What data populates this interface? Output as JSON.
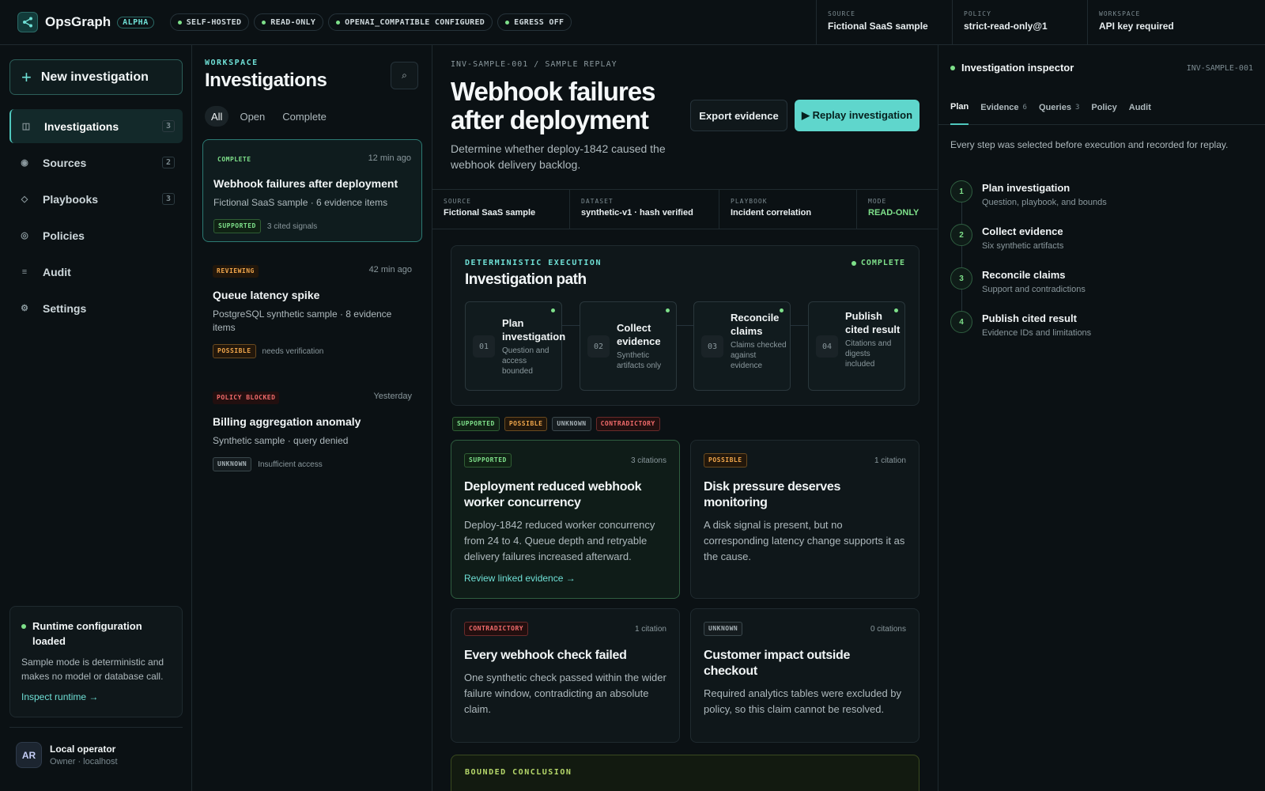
{
  "app": {
    "name": "OpsGraph",
    "badge": "ALPHA"
  },
  "header": {
    "chips": [
      "SELF-HOSTED",
      "READ-ONLY",
      "OPENAI_COMPATIBLE CONFIGURED",
      "EGRESS OFF"
    ],
    "meta": [
      {
        "label": "SOURCE",
        "value": "Fictional SaaS sample"
      },
      {
        "label": "POLICY",
        "value": "strict-read-only@1"
      },
      {
        "label": "WORKSPACE",
        "value": "API key required"
      }
    ]
  },
  "sidebar": {
    "new_button": "New investigation",
    "nav": [
      {
        "label": "Investigations",
        "count": "3",
        "icon": "grid-icon"
      },
      {
        "label": "Sources",
        "count": "2",
        "icon": "source-icon"
      },
      {
        "label": "Playbooks",
        "count": "3",
        "icon": "diamond-icon"
      },
      {
        "label": "Policies",
        "count": "",
        "icon": "policy-icon"
      },
      {
        "label": "Audit",
        "count": "",
        "icon": "list-icon"
      },
      {
        "label": "Settings",
        "count": "",
        "icon": "gear-icon"
      }
    ],
    "runtime": {
      "title": "Runtime configuration loaded",
      "body": "Sample mode is deterministic and makes no model or database call.",
      "link": "Inspect runtime →"
    },
    "user": {
      "initials": "AR",
      "name": "Local operator",
      "sub": "Owner · localhost"
    }
  },
  "list": {
    "eyebrow": "WORKSPACE",
    "title": "Investigations",
    "filters": [
      "All",
      "Open",
      "Complete"
    ],
    "items": [
      {
        "status": "COMPLETE",
        "time": "12 min ago",
        "title": "Webhook failures after deployment",
        "sub": "Fictional SaaS sample · 6 evidence items",
        "tag": "SUPPORTED",
        "note": "3 cited signals"
      },
      {
        "status": "REVIEWING",
        "time": "42 min ago",
        "title": "Queue latency spike",
        "sub": "PostgreSQL synthetic sample · 8 evidence items",
        "tag": "POSSIBLE",
        "note": "needs verification"
      },
      {
        "status": "POLICY BLOCKED",
        "time": "Yesterday",
        "title": "Billing aggregation anomaly",
        "sub": "Synthetic sample · query denied",
        "tag": "UNKNOWN",
        "note": "Insufficient access"
      }
    ]
  },
  "main": {
    "crumb": "INV-SAMPLE-001 / SAMPLE REPLAY",
    "title": "Webhook failures after deployment",
    "description": "Determine whether deploy-1842 caused the webhook delivery backlog.",
    "export_label": "Export evidence",
    "replay_label": "▶ Replay investigation",
    "meta": [
      {
        "label": "SOURCE",
        "value": "Fictional SaaS sample"
      },
      {
        "label": "DATASET",
        "value": "synthetic-v1 · hash verified"
      },
      {
        "label": "PLAYBOOK",
        "value": "Incident correlation"
      },
      {
        "label": "MODE",
        "value": "READ-ONLY"
      }
    ],
    "path": {
      "eyebrow": "DETERMINISTIC EXECUTION",
      "title": "Investigation path",
      "status": "COMPLETE",
      "steps": [
        {
          "num": "01",
          "title": "Plan investigation",
          "desc": "Question and access bounded"
        },
        {
          "num": "02",
          "title": "Collect evidence",
          "desc": "Synthetic artifacts only"
        },
        {
          "num": "03",
          "title": "Reconcile claims",
          "desc": "Claims checked against evidence"
        },
        {
          "num": "04",
          "title": "Publish cited result",
          "desc": "Citations and digests included"
        }
      ]
    },
    "legend": [
      "SUPPORTED",
      "POSSIBLE",
      "UNKNOWN",
      "CONTRADICTORY"
    ],
    "claims": [
      {
        "tag": "SUPPORTED",
        "citations": "3 citations",
        "title": "Deployment reduced webhook worker concurrency",
        "body": "Deploy-1842 reduced worker concurrency from 24 to 4. Queue depth and retryable delivery failures increased afterward.",
        "link": "Review linked evidence  →"
      },
      {
        "tag": "POSSIBLE",
        "citations": "1 citation",
        "title": "Disk pressure deserves monitoring",
        "body": "A disk signal is present, but no corresponding latency change supports it as the cause."
      },
      {
        "tag": "CONTRADICTORY",
        "citations": "1 citation",
        "title": "Every webhook check failed",
        "body": "One synthetic check passed within the wider failure window, contradicting an absolute claim."
      },
      {
        "tag": "UNKNOWN",
        "citations": "0 citations",
        "title": "Customer impact outside checkout",
        "body": "Required analytics tables were excluded by policy, so this claim cannot be resolved."
      }
    ],
    "conclusion_eyebrow": "BOUNDED CONCLUSION"
  },
  "inspector": {
    "title": "Investigation inspector",
    "id": "INV-SAMPLE-001",
    "tabs": [
      {
        "label": "Plan",
        "count": ""
      },
      {
        "label": "Evidence",
        "count": "6"
      },
      {
        "label": "Queries",
        "count": "3"
      },
      {
        "label": "Policy",
        "count": ""
      },
      {
        "label": "Audit",
        "count": ""
      }
    ],
    "description": "Every step was selected before execution and recorded for replay.",
    "plan": [
      {
        "num": "1",
        "title": "Plan investigation",
        "desc": "Question, playbook, and bounds"
      },
      {
        "num": "2",
        "title": "Collect evidence",
        "desc": "Six synthetic artifacts"
      },
      {
        "num": "3",
        "title": "Reconcile claims",
        "desc": "Support and contradictions"
      },
      {
        "num": "4",
        "title": "Publish cited result",
        "desc": "Evidence IDs and limitations"
      }
    ]
  }
}
